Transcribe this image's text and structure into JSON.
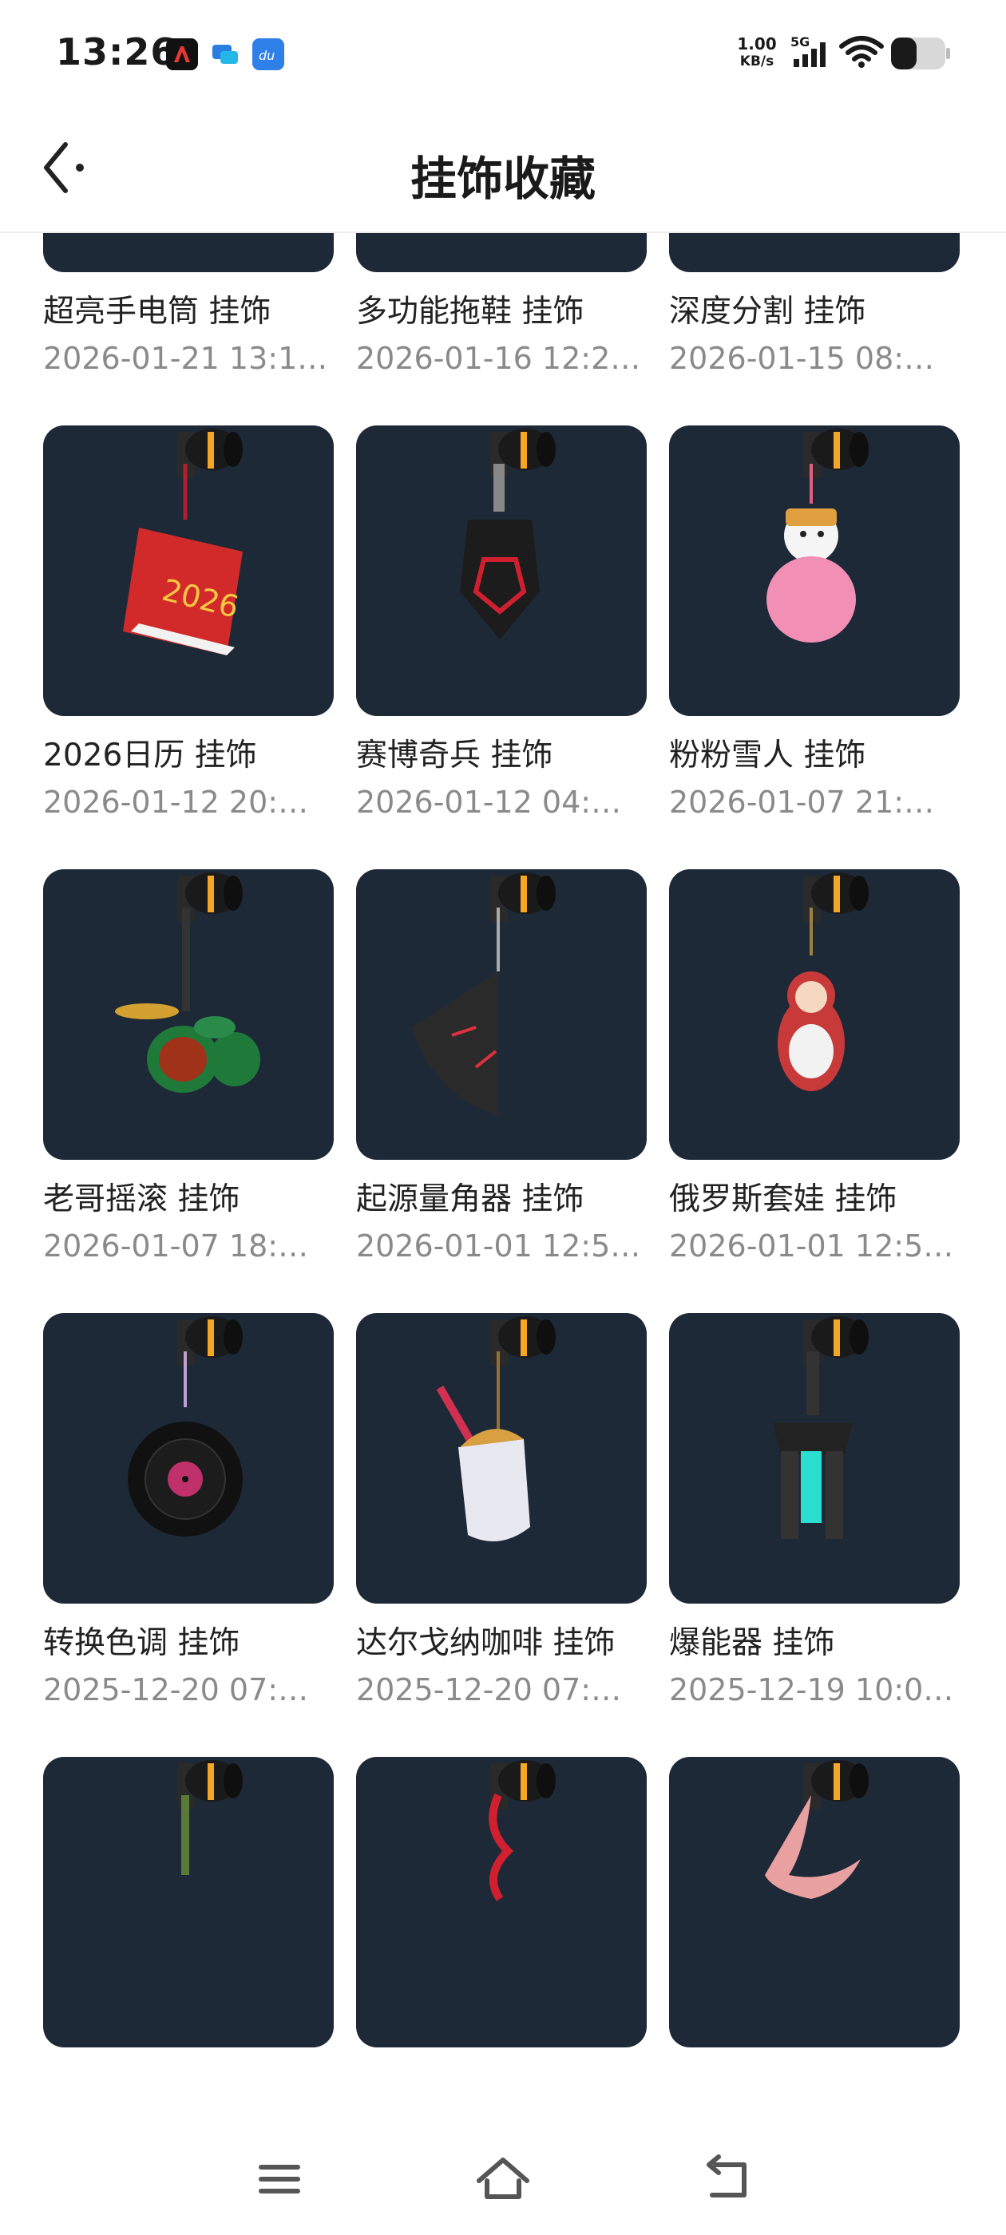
{
  "status_bar": {
    "time": "13:26",
    "net_speed_value": "1.00",
    "net_speed_unit": "KB/s",
    "signal_label": "5G",
    "apps": [
      "red-app-icon",
      "chat-app-icon",
      "du-app-icon"
    ]
  },
  "header": {
    "title": "挂饰收藏",
    "back_icon": "chevron-left-icon"
  },
  "items": [
    {
      "name": "超亮手电筒 挂饰",
      "date": "2026-01-21 13:1…",
      "icon": "flashlight-charm"
    },
    {
      "name": "多功能拖鞋 挂饰",
      "date": "2026-01-16 12:2…",
      "icon": "slipper-charm"
    },
    {
      "name": "深度分割 挂饰",
      "date": "2026-01-15 08:…",
      "icon": "floating-island-charm"
    },
    {
      "name": "2026日历 挂饰",
      "date": "2026-01-12 20:…",
      "icon": "calendar-charm"
    },
    {
      "name": "赛博奇兵 挂饰",
      "date": "2026-01-12 04:…",
      "icon": "cyber-tag-charm"
    },
    {
      "name": "粉粉雪人 挂饰",
      "date": "2026-01-07 21:…",
      "icon": "snowman-charm"
    },
    {
      "name": "老哥摇滚 挂饰",
      "date": "2026-01-07 18:…",
      "icon": "drum-kit-charm"
    },
    {
      "name": "起源量角器 挂饰",
      "date": "2026-01-01 12:5…",
      "icon": "protractor-charm"
    },
    {
      "name": "俄罗斯套娃 挂饰",
      "date": "2026-01-01 12:5…",
      "icon": "matryoshka-charm"
    },
    {
      "name": "转换色调 挂饰",
      "date": "2025-12-20 07:…",
      "icon": "vinyl-record-charm"
    },
    {
      "name": "达尔戈纳咖啡 挂饰",
      "date": "2025-12-20 07:…",
      "icon": "coffee-cup-charm"
    },
    {
      "name": "爆能器 挂饰",
      "date": "2025-12-19 10:0…",
      "icon": "blaster-charm"
    },
    {
      "name": "",
      "date": "",
      "icon": "green-charm"
    },
    {
      "name": "",
      "date": "",
      "icon": "red-knot-charm"
    },
    {
      "name": "",
      "date": "",
      "icon": "fish-charm"
    }
  ],
  "nav": {
    "menu_icon": "menu-icon",
    "home_icon": "home-icon",
    "back_icon": "back-icon"
  },
  "colors": {
    "thumb_bg": "#1e2937",
    "accent_orange": "#f5a623",
    "date_gray": "#8a8a8a"
  }
}
